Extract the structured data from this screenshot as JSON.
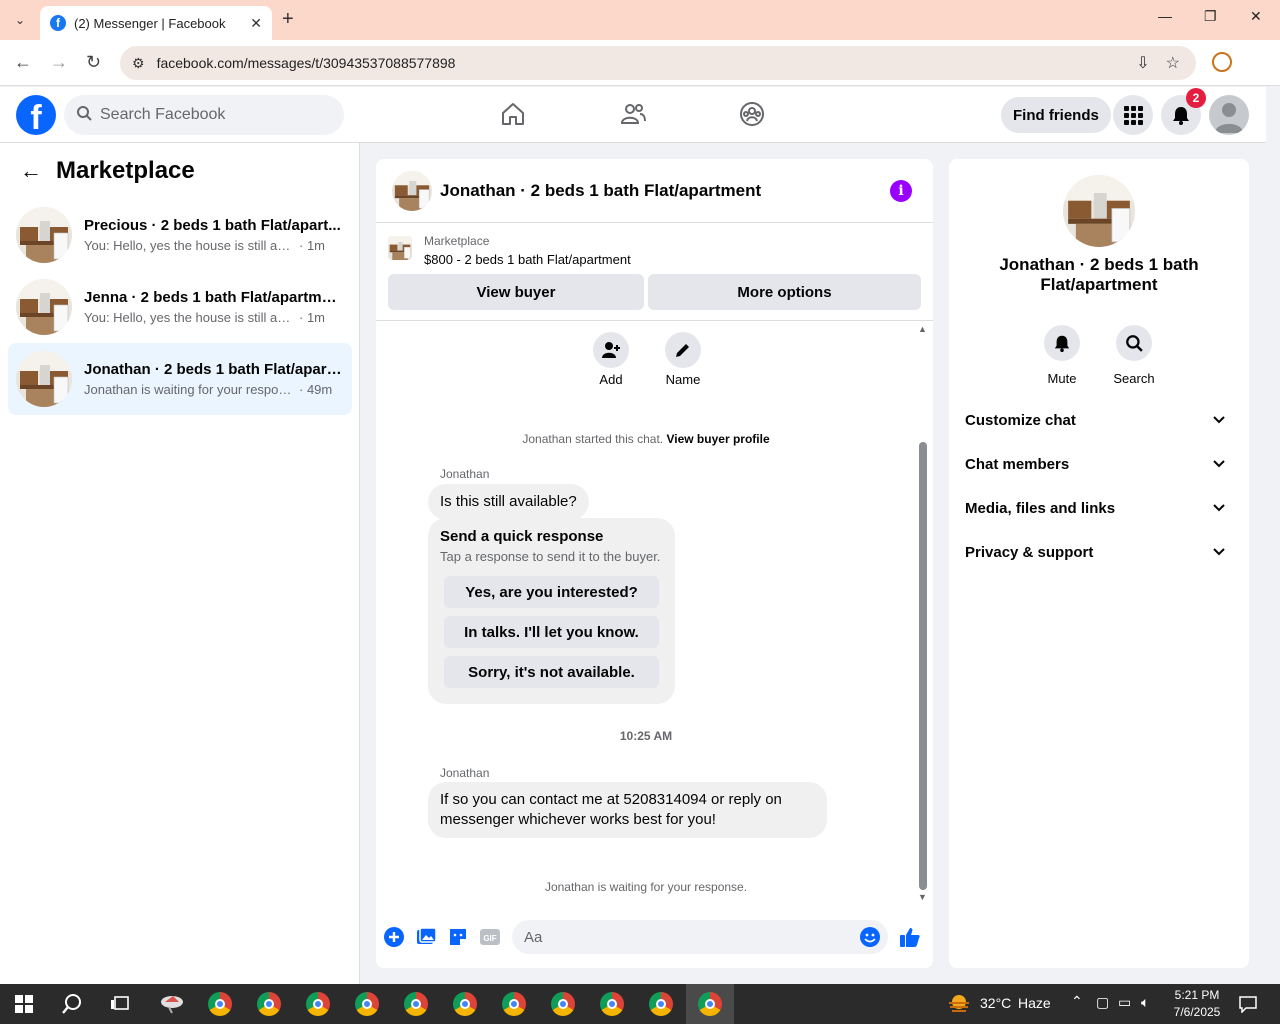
{
  "browser": {
    "tab_title": "(2) Messenger | Facebook",
    "url": "facebook.com/messages/t/30943537088577898"
  },
  "fb": {
    "search_placeholder": "Search Facebook",
    "find_friends": "Find friends",
    "notification_count": "2"
  },
  "sidebar": {
    "title": "Marketplace",
    "conversations": [
      {
        "name": "Precious · 2 beds 1 bath Flat/apart...",
        "snippet": "You: Hello, yes the house is still availa...",
        "time": "· 1m",
        "active": false
      },
      {
        "name": "Jenna · 2 beds 1 bath Flat/apartment",
        "snippet": "You: Hello, yes the house is still availa...",
        "time": "· 1m",
        "active": false
      },
      {
        "name": "Jonathan · 2 beds 1 bath Flat/apart...",
        "snippet": "Jonathan is waiting for your respon...",
        "time": "· 49m",
        "active": true
      }
    ]
  },
  "chat": {
    "header_title": "Jonathan · 2 beds 1 bath Flat/apartment",
    "marketplace_label": "Marketplace",
    "listing": "$800 - 2 beds 1 bath Flat/apartment",
    "view_buyer": "View buyer",
    "more_options": "More options",
    "add_label": "Add",
    "name_label": "Name",
    "started_text": "Jonathan started this chat.",
    "view_buyer_profile": "View buyer profile",
    "sender1": "Jonathan",
    "message1": "Is this still available?",
    "quick_title": "Send a quick response",
    "quick_sub": "Tap a response to send it to the buyer.",
    "quick_responses": [
      "Yes, are you interested?",
      "In talks. I'll let you know.",
      "Sorry, it's not available."
    ],
    "timestamp": "10:25 AM",
    "sender2": "Jonathan",
    "message2": "If so you can contact me at 5208314094 or reply on messenger whichever works best for you!",
    "waiting": "Jonathan is waiting for your response.",
    "composer_placeholder": "Aa"
  },
  "right": {
    "name": "Jonathan · 2 beds 1 bath Flat/apartment",
    "mute": "Mute",
    "search": "Search",
    "sections": [
      "Customize chat",
      "Chat members",
      "Media, files and links",
      "Privacy & support"
    ]
  },
  "taskbar": {
    "temp": "32°C",
    "weather": "Haze",
    "time": "5:21 PM",
    "date": "7/6/2025"
  },
  "colors": {
    "accent": "#0866ff",
    "info": "#9a00ff",
    "tab_bar": "#fbd8c9",
    "active_conv": "#ebf5ff"
  }
}
